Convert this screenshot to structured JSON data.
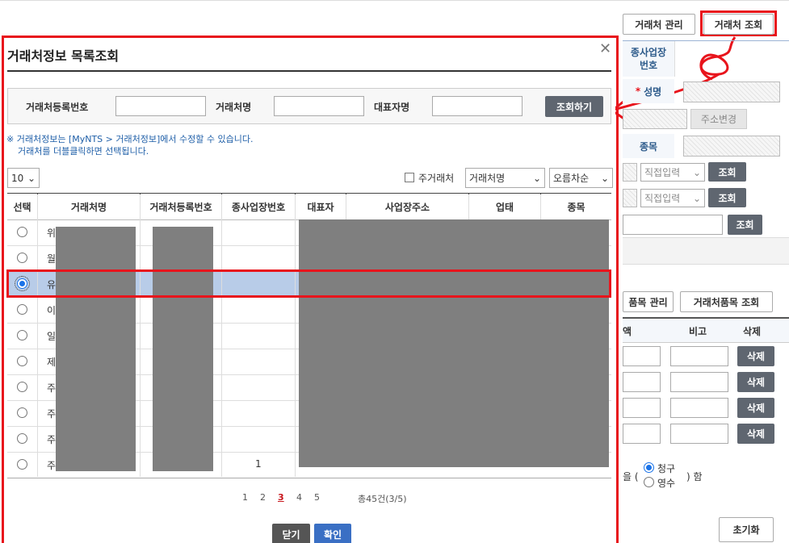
{
  "background": {
    "buttons": {
      "partner_manage": "거래처 관리",
      "partner_lookup": "거래처 조회"
    },
    "labels": {
      "sub_business_no": "종사업장\n번호",
      "name": "성명",
      "item": "종목"
    },
    "name_required_mark": "*",
    "address_change": "주소변경",
    "direct_input": "직접입력",
    "lookup": "조회",
    "product_manage": "품목 관리",
    "partner_product_lookup": "거래처품목 조회",
    "table_headers": {
      "amount": "액",
      "note": "비고",
      "delete": "삭제"
    },
    "delete_label": "삭제",
    "receipt_prefix": "을 (",
    "receipt_options": [
      "청구",
      "영수"
    ],
    "receipt_suffix": ") 함",
    "reset": "초기화"
  },
  "modal": {
    "title": "거래처정보 목록조회",
    "search": {
      "reg_no_label": "거래처등록번호",
      "name_label": "거래처명",
      "rep_label": "대표자명",
      "reg_no_value": "",
      "name_value": "",
      "rep_value": "",
      "submit": "조회하기"
    },
    "notice_lines": [
      "※ 거래처정보는 [MyNTS > 거래처정보]에서 수정할 수 있습니다.",
      "거래처를 더블클릭하면 선택됩니다."
    ],
    "page_size": "10",
    "main_partner_label": "주거래처",
    "sort_field": "거래처명",
    "sort_order": "오름차순",
    "columns": [
      "선택",
      "거래처명",
      "거래처등록번호",
      "종사업장번호",
      "대표자",
      "사업장주소",
      "업태",
      "종목"
    ],
    "rows": [
      {
        "name": "위",
        "sub_no": "",
        "selected": false
      },
      {
        "name": "월",
        "sub_no": "",
        "selected": false
      },
      {
        "name": "유",
        "sub_no": "",
        "selected": true
      },
      {
        "name": "이",
        "sub_no": "",
        "selected": false
      },
      {
        "name": "일",
        "sub_no": "",
        "selected": false
      },
      {
        "name": "제",
        "sub_no": "",
        "selected": false
      },
      {
        "name": "주",
        "sub_no": "",
        "selected": false
      },
      {
        "name": "주",
        "sub_no": "",
        "selected": false
      },
      {
        "name": "주",
        "sub_no": "",
        "selected": false
      },
      {
        "name": "주",
        "sub_no": "1",
        "selected": false
      }
    ],
    "pagination": {
      "pages": [
        "1",
        "2",
        "3",
        "4",
        "5"
      ],
      "current": "3",
      "total": "총45건(3/5)"
    },
    "close_button": "닫기",
    "confirm_button": "확인"
  },
  "colors": {
    "highlight_red": "#e8141c",
    "selected_row": "#b8cce8",
    "button_gray": "#5f6670",
    "confirm_blue": "#3a6fc4"
  }
}
